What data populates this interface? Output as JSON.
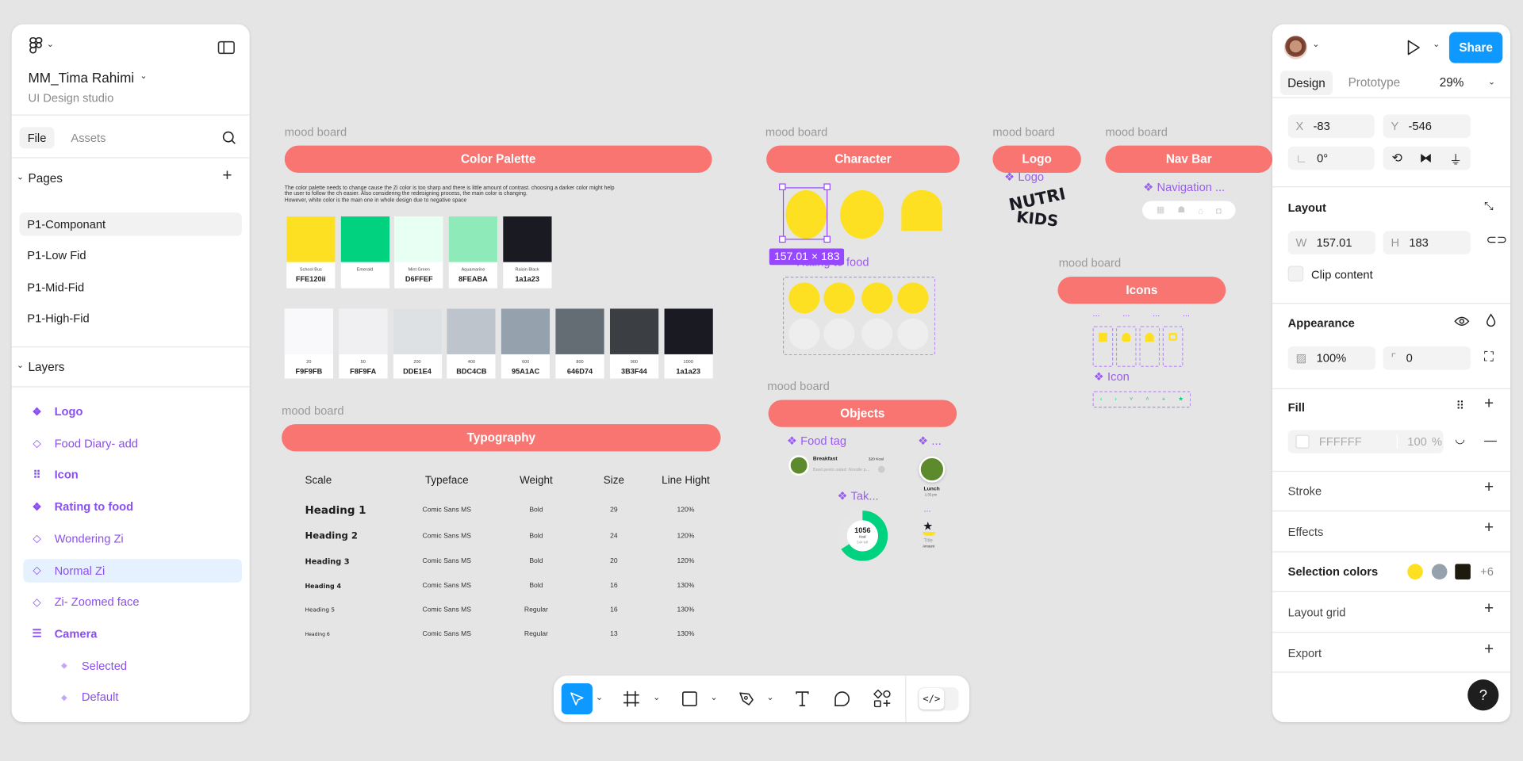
{
  "left_panel": {
    "file_name": "MM_Tima Rahimi",
    "team": "UI Design studio",
    "tabs": [
      "File",
      "Assets"
    ],
    "pages_header": "Pages",
    "pages": [
      "P1-Componant",
      "P1-Low Fid",
      "P1-Mid-Fid",
      "P1-High-Fid"
    ],
    "selected_page": "P1-Componant",
    "layers_header": "Layers",
    "layers": [
      {
        "label": "Logo",
        "icon": "component-icon",
        "bold": true
      },
      {
        "label": "Food Diary- add",
        "icon": "instance-icon",
        "bold": false
      },
      {
        "label": "Icon",
        "icon": "grid-icon",
        "bold": true
      },
      {
        "label": "Rating to food",
        "icon": "component-icon",
        "bold": true
      },
      {
        "label": "Wondering Zi",
        "icon": "instance-icon",
        "bold": false
      },
      {
        "label": "Normal Zi",
        "icon": "instance-icon",
        "bold": false,
        "selected": true
      },
      {
        "label": "Zi- Zoomed face",
        "icon": "instance-icon",
        "bold": false
      },
      {
        "label": "Camera",
        "icon": "auto-layout-icon",
        "bold": true
      },
      {
        "label": "Selected",
        "icon": "variant-icon",
        "bold": false,
        "indent": true
      },
      {
        "label": "Default",
        "icon": "variant-icon",
        "bold": false,
        "indent": true
      }
    ]
  },
  "right_panel": {
    "share_label": "Share",
    "tabs": [
      "Design",
      "Prototype"
    ],
    "zoom": "29%",
    "x": "-83",
    "y": "-546",
    "rotation": "0°",
    "x_label": "X",
    "y_label": "Y",
    "w_label": "W",
    "h_label": "H",
    "layout_header": "Layout",
    "w": "157.01",
    "h": "183",
    "clip_content": "Clip content",
    "appearance_header": "Appearance",
    "opacity": "100%",
    "corner_radius": "0",
    "fill_header": "Fill",
    "fill_hex": "FFFFFF",
    "fill_opacity": "100",
    "fill_pct": "%",
    "stroke_header": "Stroke",
    "effects_header": "Effects",
    "selection_colors_header": "Selection colors",
    "selection_colors": [
      "#fde021",
      "#95a1ac",
      "#1e1a0e"
    ],
    "selection_more": "+6",
    "layout_grid_header": "Layout grid",
    "export_header": "Export",
    "help": "?"
  },
  "canvas": {
    "mood_board_label": "mood board",
    "color_palette": {
      "title": "Color Palette",
      "description": [
        "The color palette needs to change cause the Zi color is too sharp and there is little amount of contrast. choosing a darker color might help",
        "the user to follow the ch easier. Also considering the redesigning process, the main color is changing.",
        "However, white color is the main one in whole design due to negative space"
      ],
      "primary": [
        {
          "name": "School Bus",
          "hex": "FFE120ii",
          "color": "#fde021"
        },
        {
          "name": "Emerald",
          "hex": "",
          "color": "#00d27f"
        },
        {
          "name": "Mint Green",
          "hex": "D6FFEF",
          "color": "#e8fff4"
        },
        {
          "name": "Aquamarine",
          "hex": "8FEABA",
          "color": "#8feaba"
        },
        {
          "name": "Raisin Black",
          "hex": "1a1a23",
          "color": "#1a1a23"
        }
      ],
      "neutrals": [
        {
          "name": "20",
          "hex": "F9F9FB",
          "color": "#f9f9fb"
        },
        {
          "name": "50",
          "hex": "F8F9FA",
          "color": "#f0f0f2"
        },
        {
          "name": "200",
          "hex": "DDE1E4",
          "color": "#dde1e4"
        },
        {
          "name": "400",
          "hex": "BDC4CB",
          "color": "#bdc4cb"
        },
        {
          "name": "600",
          "hex": "95A1AC",
          "color": "#95a1ac"
        },
        {
          "name": "800",
          "hex": "646D74",
          "color": "#646d74"
        },
        {
          "name": "900",
          "hex": "3B3F44",
          "color": "#3b3f44"
        },
        {
          "name": "1000",
          "hex": "1a1a23",
          "color": "#1a1a23"
        }
      ]
    },
    "typography": {
      "title": "Typography",
      "headers": [
        "Scale",
        "Typeface",
        "Weight",
        "Size",
        "Line Hight"
      ],
      "rows": [
        [
          "Heading 1",
          "Comic Sans MS",
          "Bold",
          "29",
          "120%"
        ],
        [
          "Heading 2",
          "Comic Sans MS",
          "Bold",
          "24",
          "120%"
        ],
        [
          "Heading 3",
          "Comic Sans MS",
          "Bold",
          "20",
          "120%"
        ],
        [
          "Heading 4",
          "Comic Sans MS",
          "Bold",
          "16",
          "130%"
        ],
        [
          "Heading 5",
          "Comic Sans MS",
          "Regular",
          "16",
          "130%"
        ],
        [
          "Heading 6",
          "Comic Sans MS",
          "Regular",
          "13",
          "130%"
        ]
      ]
    },
    "character": {
      "title": "Character",
      "size_badge": "157.01 × 183",
      "rating_label": "Rating to food"
    },
    "logo": {
      "title": "Logo",
      "component_label": "Logo",
      "logo_text_1": "NUTRI",
      "logo_text_2": "KIDS"
    },
    "nav_bar": {
      "title": "Nav Bar",
      "component_label": "Navigation ..."
    },
    "icons": {
      "title": "Icons",
      "component_label": "Icon",
      "dots": "..."
    },
    "objects": {
      "title": "Objects",
      "food_tag_label": "Food tag",
      "other_label": "...",
      "meal": "Breakfast",
      "kcal": "320 Kcal",
      "meal_desc": "Basil pesto salad: Noodle p...",
      "lunch": "Lunch",
      "lunch_time": "1:35 pm",
      "take_label": "Tak...",
      "donut_value": "1056",
      "donut_unit": "Kcal",
      "donut_left": "544 left",
      "donut_fraction": 0.66,
      "dots": "...",
      "badge_title": "Title",
      "badge_amount": "Amount"
    }
  },
  "toolbar": {
    "tools": [
      "move-tool",
      "frame-tool",
      "rectangle-tool",
      "pen-tool",
      "text-tool",
      "comment-tool",
      "assets-tool"
    ],
    "active": "move-tool",
    "accent": "#0d99ff"
  }
}
